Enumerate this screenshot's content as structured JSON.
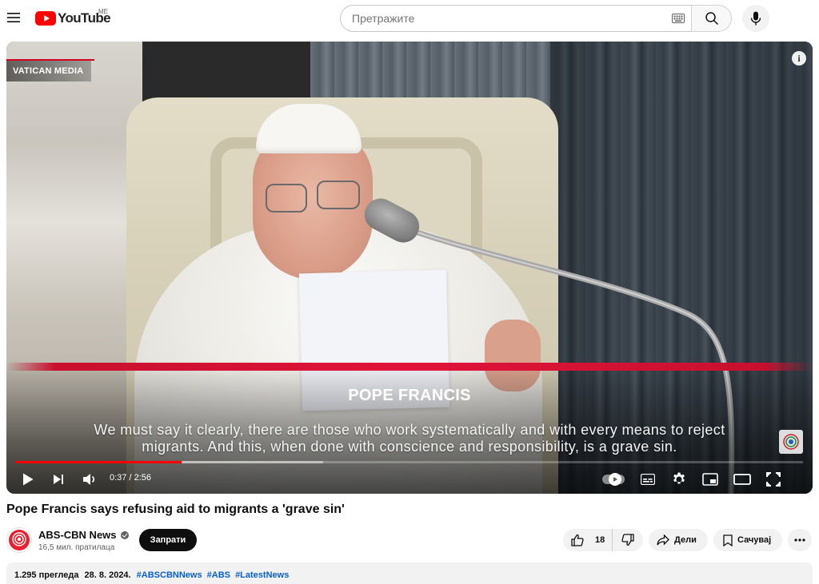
{
  "masthead": {
    "logo_text": "YouTube",
    "region": "ME",
    "search_placeholder": "Претражите"
  },
  "player": {
    "source_tag": "VATICAN MEDIA",
    "speaker_name": "POPE FRANCIS",
    "caption_line1": "We must say it clearly, there are those who work systematically and with every means to reject",
    "caption_line2": "migrants. And this, when done with conscience and responsibility, is a grave sin.",
    "time_current": "0:37",
    "time_separator": " / ",
    "time_total": "2:56",
    "progress_played_fraction": 0.21,
    "progress_buffered_fraction": 0.39,
    "autoplay_on": true
  },
  "video": {
    "title": "Pope Francis says refusing aid to migrants a 'grave sin'"
  },
  "channel": {
    "name": "ABS-CBN News",
    "subscribers": "16,5 мил. пратилаца",
    "subscribe_label": "Запрати"
  },
  "actions": {
    "like_count": "18",
    "share_label": "Дели",
    "save_label": "Сачувај"
  },
  "description": {
    "views": "1.295 прегледа",
    "date": "28. 8. 2024.",
    "hashtags": [
      "#ABSCBNNews",
      "#ABS",
      "#LatestNews"
    ]
  },
  "colors": {
    "brand_red": "#ff0000",
    "lower_third_red": "#e0143a",
    "link_blue": "#065fd4"
  }
}
